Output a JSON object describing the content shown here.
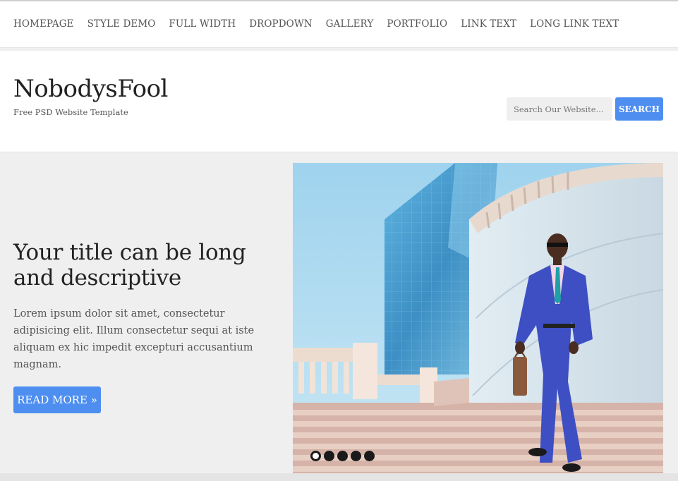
{
  "nav": {
    "items": [
      {
        "label": "HOMEPAGE"
      },
      {
        "label": "STYLE DEMO"
      },
      {
        "label": "FULL WIDTH"
      },
      {
        "label": "DROPDOWN"
      },
      {
        "label": "GALLERY"
      },
      {
        "label": "PORTFOLIO"
      },
      {
        "label": "LINK TEXT"
      },
      {
        "label": "LONG LINK TEXT"
      }
    ]
  },
  "header": {
    "site_title": "NobodysFool",
    "tagline": "Free PSD Website Template",
    "search": {
      "placeholder": "Search Our Website...",
      "button_label": "SEARCH"
    }
  },
  "hero": {
    "title": "Your title can be long and descriptive",
    "body": "Lorem ipsum dolor sit amet, consectetur adipisicing elit. Illum consectetur sequi at iste aliquam ex hic impedit excepturi accusantium magnam.",
    "button_label": "READ MORE »",
    "slider": {
      "slide_count": 5,
      "active_slide": 1
    }
  },
  "colors": {
    "accent": "#4d8ef0",
    "page_background": "#efefef"
  }
}
